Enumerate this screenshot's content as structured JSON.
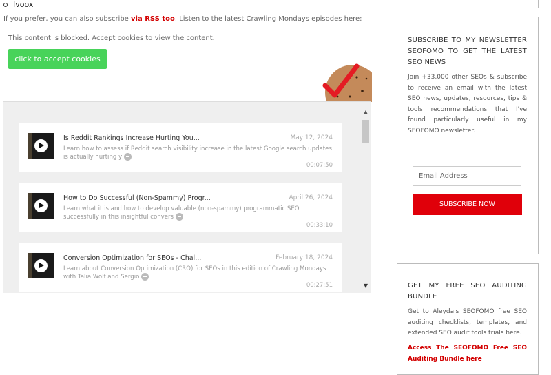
{
  "main": {
    "bullet_link": "Ivoox",
    "intro_prefix": "If you prefer, you can also subscribe ",
    "intro_link": "via RSS too",
    "intro_suffix": ". Listen to the latest Crawling Mondays episodes here:",
    "blocked_text": "This content is blocked. Accept cookies to view the content.",
    "accept_button": "click to accept cookies"
  },
  "episodes": [
    {
      "title": "Is Reddit Rankings Increase Hurting You...",
      "date": "May 12, 2024",
      "description": "Learn how to assess if Reddit search visibility increase in the latest Google search updates is actually hurting y",
      "duration": "00:07:50"
    },
    {
      "title": "How to Do Successful (Non-Spammy) Progr...",
      "date": "April 26, 2024",
      "description": "Learn what it is and how to develop valuable (non-spammy) programmatic SEO successfully in this insightful convers",
      "duration": "00:33:10"
    },
    {
      "title": "Conversion Optimization for SEOs - Chal...",
      "date": "February 18, 2024",
      "description": "Learn about Conversion Optimization (CRO) for SEOs in this edition of Crawling Mondays with Talia Wolf and Sergio",
      "duration": "00:27:51"
    }
  ],
  "newsletter": {
    "title": "Subscribe to my newsletter SEOFOMO to get the latest SEO news",
    "text": "Join +33,000 other SEOs & subscribe to receive an email with the latest SEO news, updates, resources, tips & tools recommendations that I've found particularly useful in my SEOFOMO newsletter.",
    "email_placeholder": "Email Address",
    "button": "Subscribe now"
  },
  "bundle": {
    "title": "Get my free SEO Auditing Bundle",
    "text": "Get to Aleyda's SEOFOMO free SEO auditing checklists, templates, and extended SEO audit tools trials here.",
    "link": "Access The SEOFOMO Free SEO Auditing Bundle here"
  },
  "colors": {
    "accent_red": "#d30000",
    "accept_green": "#48d35a",
    "subscribe_red": "#e0000a"
  }
}
